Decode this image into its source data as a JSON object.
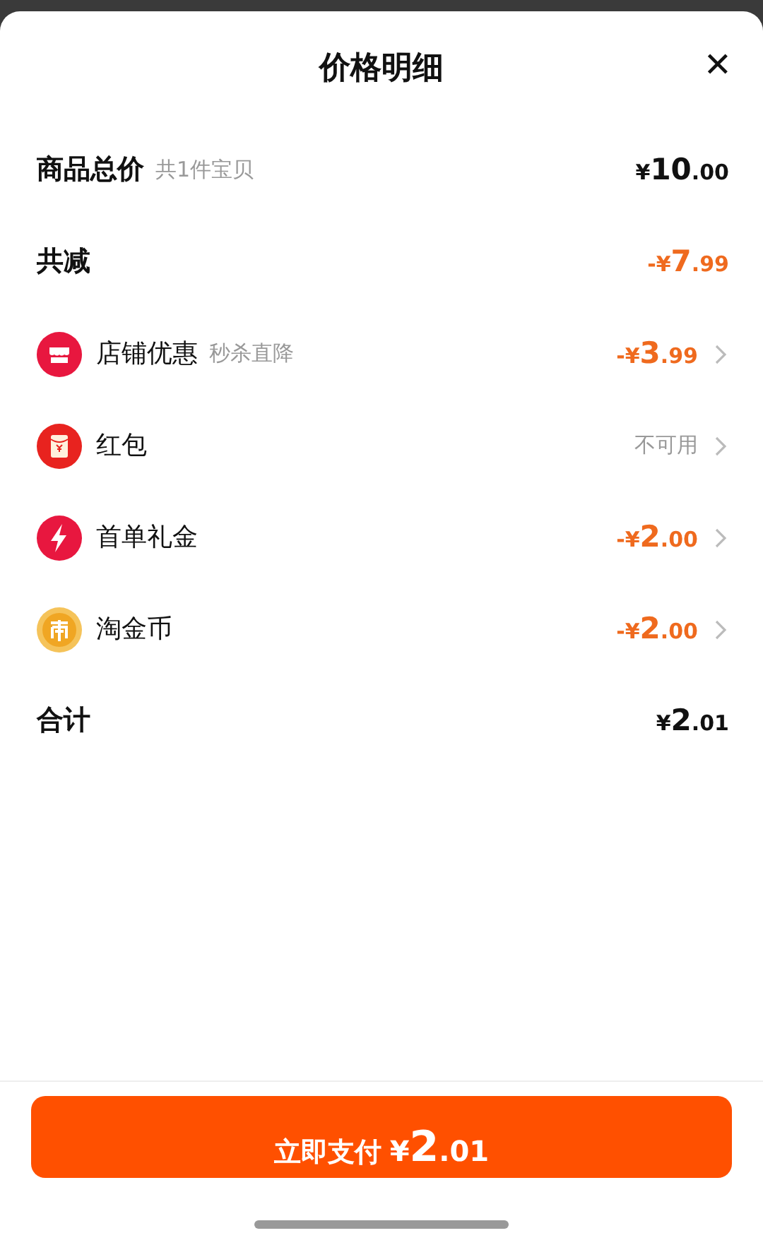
{
  "sheet": {
    "title": "价格明细",
    "close": "✕"
  },
  "rows": [
    {
      "kind": "total",
      "label": "商品总价",
      "note": "共1件宝贝",
      "amount": {
        "prefix": "¥",
        "whole": "10",
        "cents": ".00"
      }
    },
    {
      "kind": "reduction",
      "label": "共减",
      "amount": {
        "prefix": "-¥",
        "whole": "7",
        "cents": ".99"
      }
    },
    {
      "kind": "shop",
      "label": "店铺优惠",
      "note": "秒杀直降",
      "amount": {
        "prefix": "-¥",
        "whole": "3",
        "cents": ".99"
      }
    },
    {
      "kind": "packet",
      "label": "红包",
      "status": "不可用"
    },
    {
      "kind": "bolt",
      "label": "首单礼金",
      "amount": {
        "prefix": "-¥",
        "whole": "2",
        "cents": ".00"
      }
    },
    {
      "kind": "coin",
      "label": "淘金币",
      "amount": {
        "prefix": "-¥",
        "whole": "2",
        "cents": ".00"
      }
    },
    {
      "kind": "total",
      "label": "合计",
      "amount": {
        "prefix": "¥",
        "whole": "2",
        "cents": ".01"
      }
    }
  ],
  "pay_button": {
    "label": "立即支付",
    "amount": {
      "prefix": "¥",
      "whole": "2",
      "cents": ".01"
    }
  }
}
